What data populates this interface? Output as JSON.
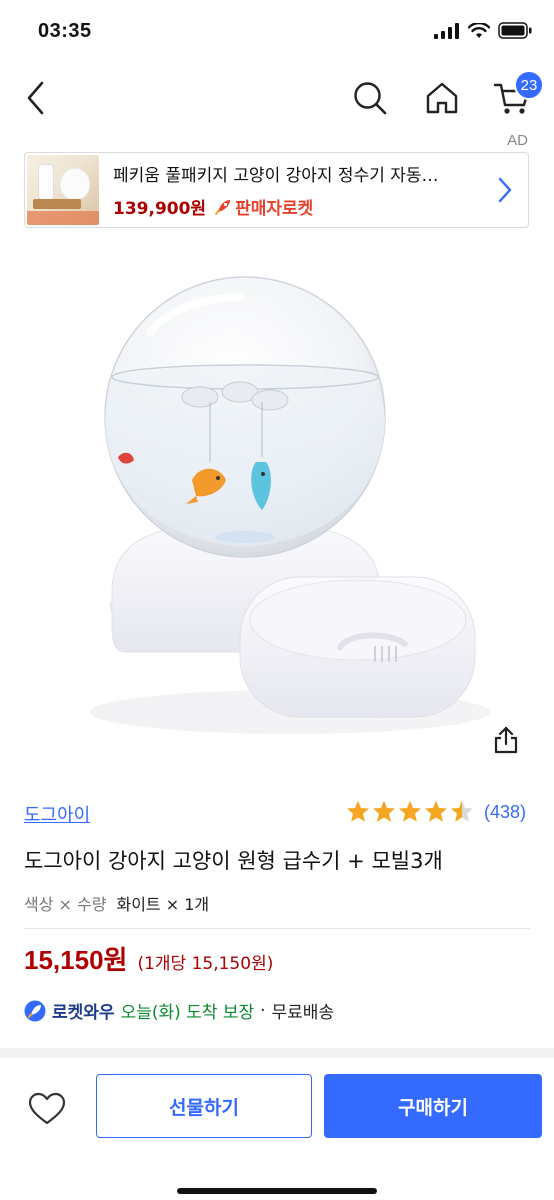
{
  "status_bar": {
    "time": "03:35"
  },
  "nav": {
    "cart_count": "23"
  },
  "ad": {
    "label": "AD",
    "title": "페키움 풀패키지 고양이 강아지 정수기 자동…",
    "price": "139,900원",
    "badge": "판매자로켓"
  },
  "product": {
    "brand": "도그아이",
    "rating_value": 4.5,
    "rating_count": "(438)",
    "title": "도그아이 강아지 고양이 원형 급수기 + 모빌3개",
    "option_keys": "색상 × 수량",
    "option_values": "화이트 × 1개",
    "price": "15,150원",
    "unit_price": "(1개당 15,150원)",
    "delivery": {
      "rocket": "로켓와우",
      "date": "오늘(화) 도착 보장",
      "separator": "·",
      "shipping": "무료배송"
    }
  },
  "bottom_bar": {
    "gift_label": "선물하기",
    "buy_label": "구매하기"
  },
  "colors": {
    "accent": "#346aff",
    "price": "#ae0000",
    "delivery_green": "#0a8a2e",
    "star": "#f5a623"
  }
}
